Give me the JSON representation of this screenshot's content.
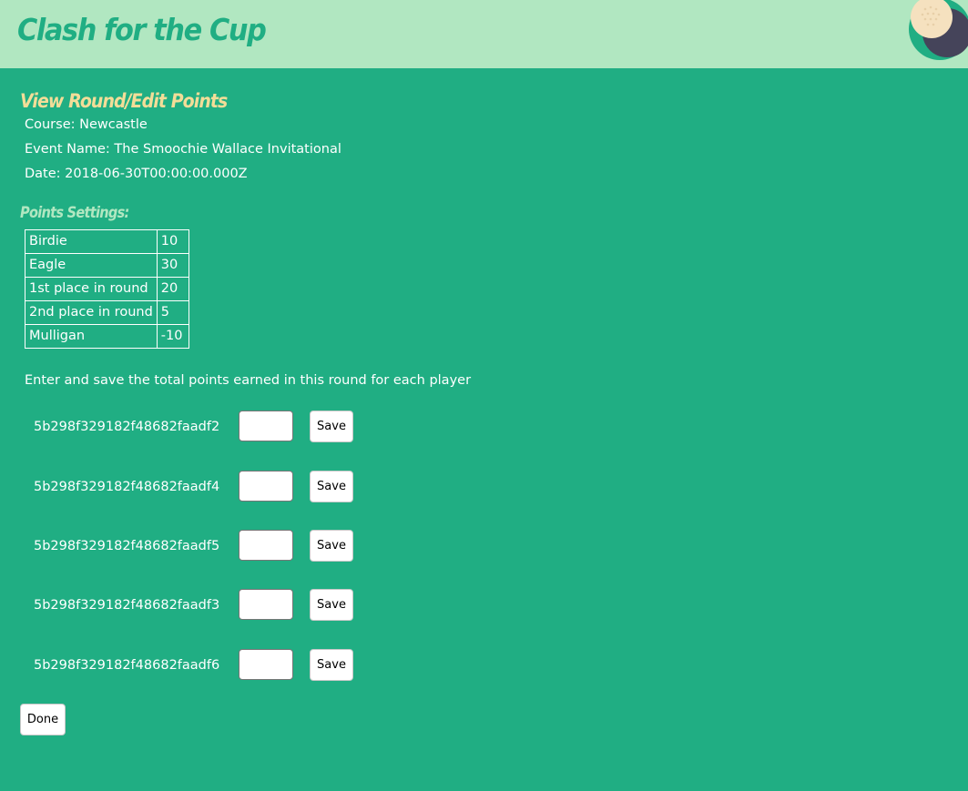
{
  "header": {
    "app_title": "Clash for the Cup",
    "logo_icon": "golf-ball-moon-logo"
  },
  "round": {
    "heading": "View Round/Edit Points",
    "course": "Course: Newcastle",
    "event_name": "Event Name: The Smoochie Wallace Invitational",
    "date": "Date: 2018-06-30T00:00:00.000Z"
  },
  "points_settings": {
    "heading": "Points Settings:",
    "rows": [
      {
        "name": "Birdie",
        "value": "10"
      },
      {
        "name": "Eagle",
        "value": "30"
      },
      {
        "name": "1st place in round",
        "value": "20"
      },
      {
        "name": "2nd place in round",
        "value": "5"
      },
      {
        "name": "Mulligan",
        "value": "-10"
      }
    ]
  },
  "entry": {
    "instructions": "Enter and save the total points earned in this round for each player",
    "save_label": "Save",
    "players": [
      {
        "id": "5b298f329182f48682faadf2",
        "points": ""
      },
      {
        "id": "5b298f329182f48682faadf4",
        "points": ""
      },
      {
        "id": "5b298f329182f48682faadf5",
        "points": ""
      },
      {
        "id": "5b298f329182f48682faadf3",
        "points": ""
      },
      {
        "id": "5b298f329182f48682faadf6",
        "points": ""
      }
    ]
  },
  "footer": {
    "done_label": "Done"
  },
  "colors": {
    "background": "#20ae83",
    "header": "#b1e7c1",
    "title_text": "#20ae83",
    "page_heading": "#f3dd98",
    "section_heading": "#b1e7c1"
  }
}
